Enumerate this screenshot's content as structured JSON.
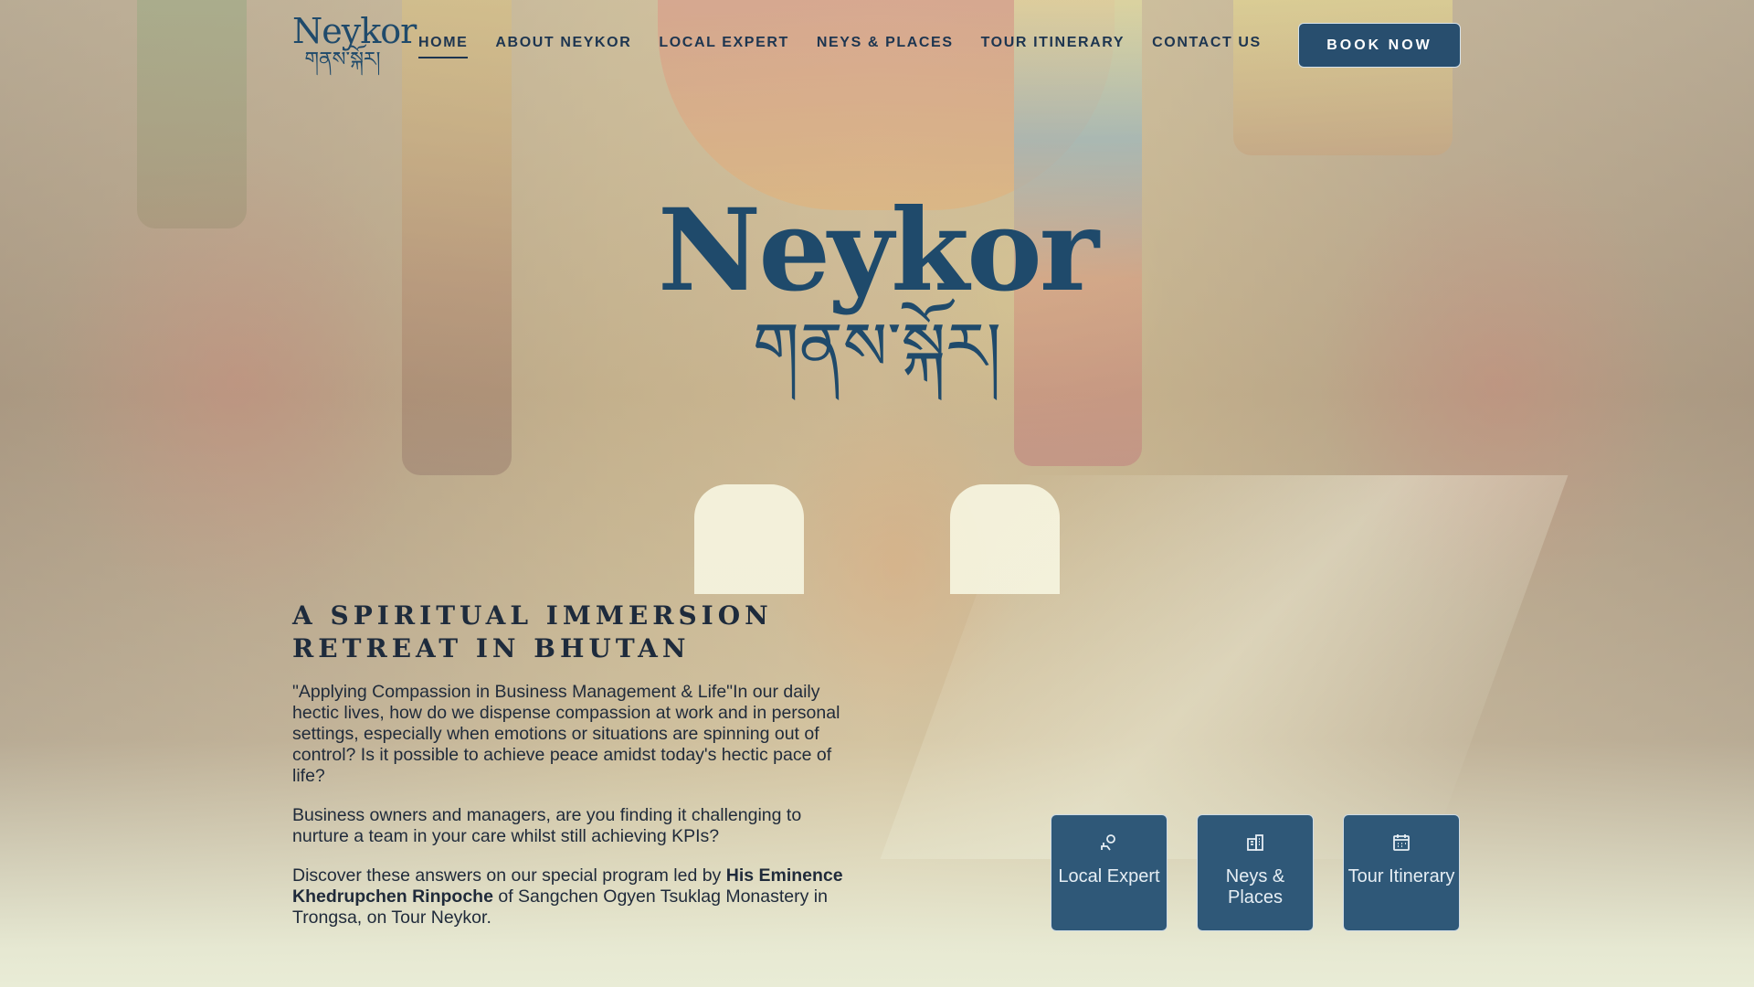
{
  "brand": {
    "name": "Neykor",
    "tibetan": "གནས་སྐོར།"
  },
  "nav": {
    "items": [
      {
        "label": "HOME"
      },
      {
        "label": "ABOUT NEYKOR"
      },
      {
        "label": "LOCAL EXPERT"
      },
      {
        "label": "NEYS & PLACES"
      },
      {
        "label": "TOUR ITINERARY"
      },
      {
        "label": "CONTACT US"
      }
    ],
    "cta": "BOOK NOW"
  },
  "hero": {
    "title": "Neykor",
    "tibetan": "གནས་སྐོར།"
  },
  "intro": {
    "subtitle_line1": "A SPIRITUAL IMMERSION",
    "subtitle_line2": "RETREAT IN BHUTAN",
    "p1": "\"Applying Compassion in Business Management & Life\"In our daily hectic lives, how do we dispense compassion at work and in personal settings, especially when emotions or situations are spinning out of control? Is it possible to achieve peace amidst today's hectic pace of life?",
    "p2": "Business owners and managers, are you finding it challenging to nurture a team in your care whilst still achieving KPIs?",
    "p3_start": "Discover these answers on our special program led by ",
    "p3_bold": "His Eminence Khedrupchen Rinpoche",
    "p3_end": " of Sangchen Ogyen Tsuklag Monastery in Trongsa, on Tour Neykor."
  },
  "cards": [
    {
      "label": "Local Expert",
      "icon": "person-icon"
    },
    {
      "label": "Neys & Places",
      "icon": "building-icon"
    },
    {
      "label": "Tour Itinerary",
      "icon": "calendar-icon"
    }
  ],
  "colors": {
    "primary": "#284e6e",
    "text": "#1d3550",
    "background": "#e9ecd6"
  }
}
